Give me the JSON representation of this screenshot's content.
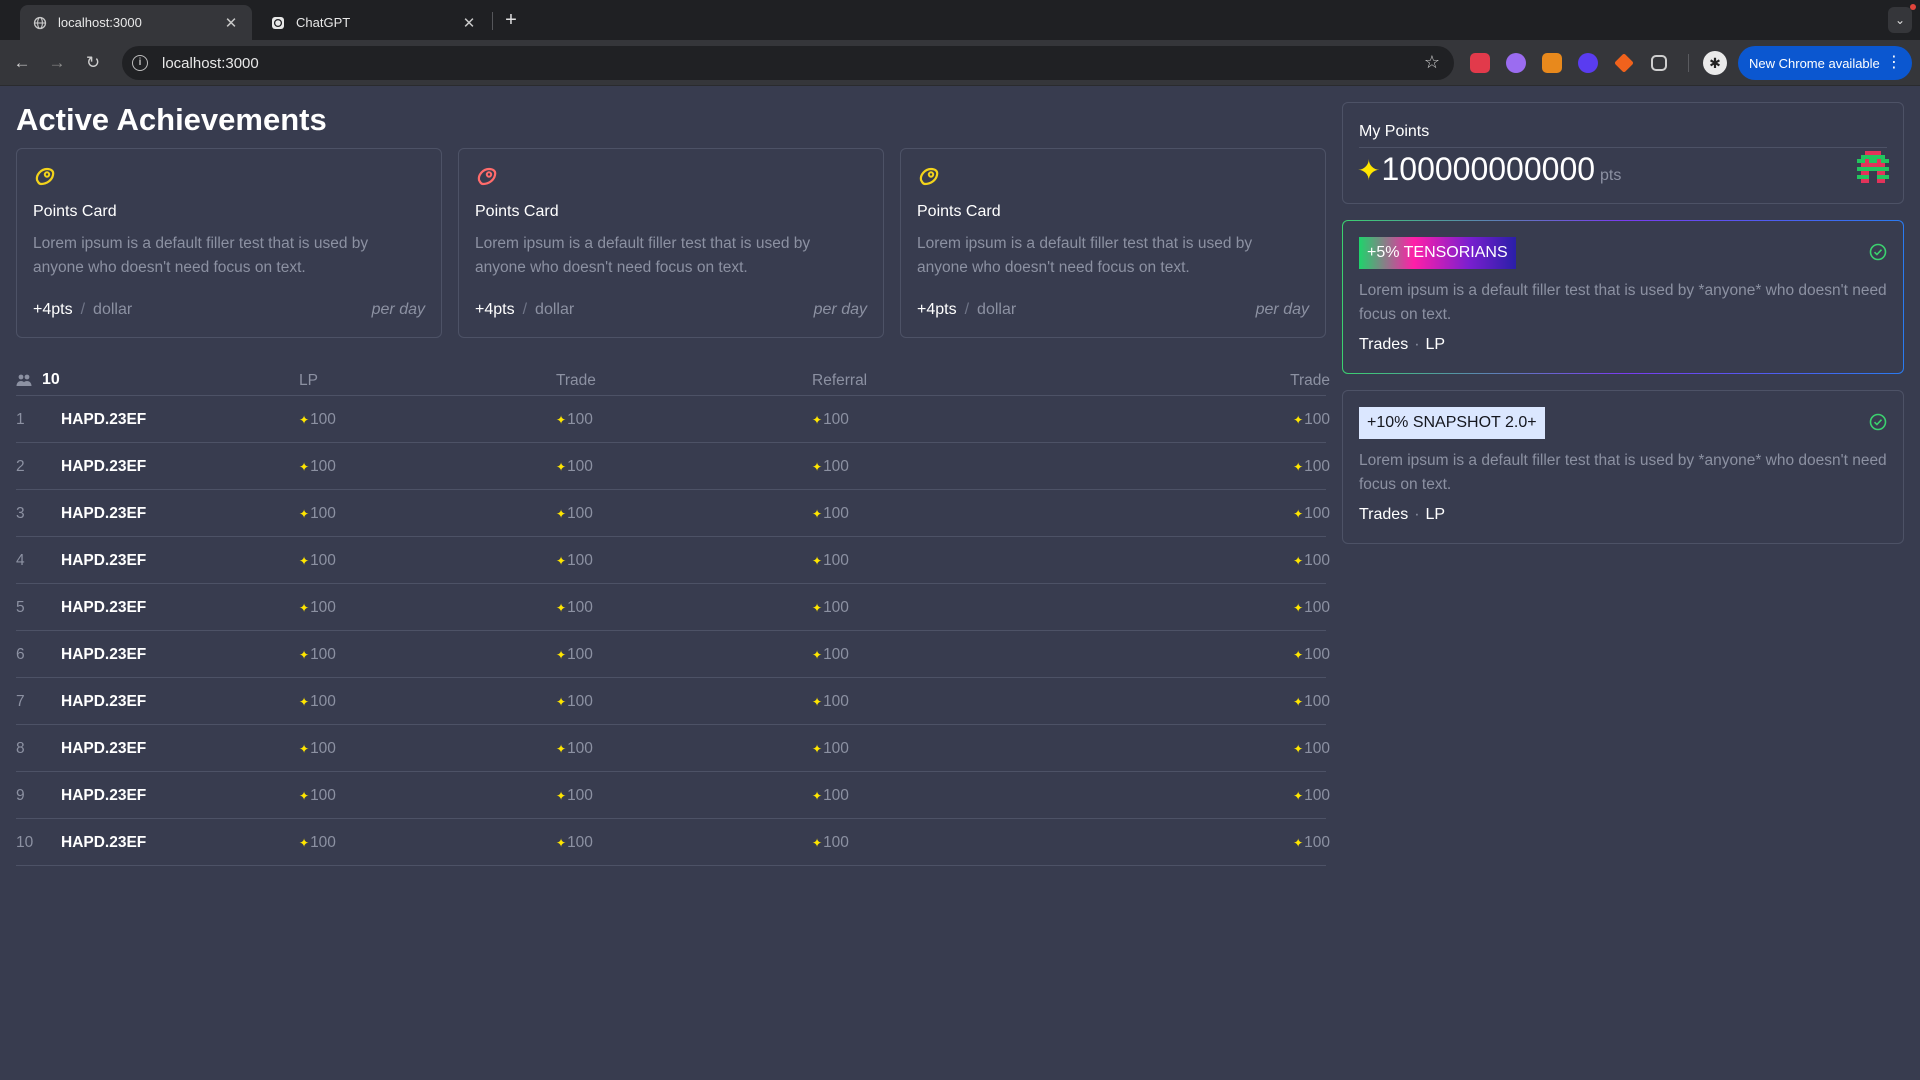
{
  "browser": {
    "tabs": [
      {
        "title": "localhost:3000",
        "active": true,
        "icon": "globe-icon"
      },
      {
        "title": "ChatGPT",
        "active": false,
        "icon": "chatgpt-icon"
      }
    ],
    "url": "localhost:3000",
    "update_button": "New Chrome available"
  },
  "page": {
    "title": "Active Achievements",
    "cards": [
      {
        "icon": "steak-icon",
        "icon_color": "#f2d31b",
        "title": "Points Card",
        "description": "Lorem ipsum is a default filler test that is used by anyone who doesn't need focus on text.",
        "points": "+4pts",
        "unit": "dollar",
        "frequency": "per day"
      },
      {
        "icon": "steak-icon",
        "icon_color": "#ff6b6b",
        "title": "Points Card",
        "description": "Lorem ipsum is a default filler test that is used by anyone who doesn't need focus on text.",
        "points": "+4pts",
        "unit": "dollar",
        "frequency": "per day"
      },
      {
        "icon": "steak-icon",
        "icon_color": "#f2d31b",
        "title": "Points Card",
        "description": "Lorem ipsum is a default filler test that is used by anyone who doesn't need focus on text.",
        "points": "+4pts",
        "unit": "dollar",
        "frequency": "per day"
      }
    ],
    "table": {
      "count": "10",
      "headers": [
        "LP",
        "Trade",
        "Referral",
        "Trade"
      ],
      "rows": [
        {
          "rank": "1",
          "name": "HAPD.23EF",
          "lp": "100",
          "trade": "100",
          "referral": "100",
          "trade2": "100"
        },
        {
          "rank": "2",
          "name": "HAPD.23EF",
          "lp": "100",
          "trade": "100",
          "referral": "100",
          "trade2": "100"
        },
        {
          "rank": "3",
          "name": "HAPD.23EF",
          "lp": "100",
          "trade": "100",
          "referral": "100",
          "trade2": "100"
        },
        {
          "rank": "4",
          "name": "HAPD.23EF",
          "lp": "100",
          "trade": "100",
          "referral": "100",
          "trade2": "100"
        },
        {
          "rank": "5",
          "name": "HAPD.23EF",
          "lp": "100",
          "trade": "100",
          "referral": "100",
          "trade2": "100"
        },
        {
          "rank": "6",
          "name": "HAPD.23EF",
          "lp": "100",
          "trade": "100",
          "referral": "100",
          "trade2": "100"
        },
        {
          "rank": "7",
          "name": "HAPD.23EF",
          "lp": "100",
          "trade": "100",
          "referral": "100",
          "trade2": "100"
        },
        {
          "rank": "8",
          "name": "HAPD.23EF",
          "lp": "100",
          "trade": "100",
          "referral": "100",
          "trade2": "100"
        },
        {
          "rank": "9",
          "name": "HAPD.23EF",
          "lp": "100",
          "trade": "100",
          "referral": "100",
          "trade2": "100"
        },
        {
          "rank": "10",
          "name": "HAPD.23EF",
          "lp": "100",
          "trade": "100",
          "referral": "100",
          "trade2": "100"
        }
      ]
    }
  },
  "sidebar": {
    "points": {
      "label": "My Points",
      "value": "100000000000",
      "unit": "pts"
    },
    "boosts": [
      {
        "badge": "+5% TENSORIANS",
        "description": "Lorem ipsum is a default filler test that is used by *anyone* who doesn't need focus on text.",
        "tags": [
          "Trades",
          "LP"
        ],
        "checked": true
      },
      {
        "badge": "+10% SNAPSHOT 2.0+",
        "description": "Lorem ipsum is a default filler test that is used by *anyone* who doesn't need focus on text.",
        "tags": [
          "Trades",
          "LP"
        ],
        "checked": true
      }
    ]
  },
  "colors": {
    "background": "#383c4f",
    "sparkle": "#ffe600",
    "check": "#3bd16f",
    "update_button": "#0b57d0"
  }
}
